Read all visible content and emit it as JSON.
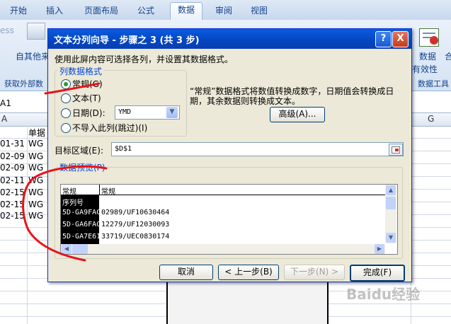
{
  "ribbon": {
    "tabs": [
      "开始",
      "插入",
      "页面布局",
      "公式",
      "数据",
      "审阅",
      "视图"
    ],
    "active_tab": "数据",
    "left_btn_fragment": "ess",
    "left_btn_label": "自其他来",
    "left_group_label": "获取外部数",
    "right_btn_label": "数据",
    "right_btn_label2": "有效性",
    "right_group_label": "数据工具",
    "right_edge_label": "合"
  },
  "sheet": {
    "name_box": "A1",
    "col_a": "A",
    "col_g": "G",
    "header_cell": "单据",
    "rows": [
      {
        "date": "01-31",
        "code": "WG"
      },
      {
        "date": "02-09",
        "code": "WG"
      },
      {
        "date": "02-09",
        "code": "WG"
      },
      {
        "date": "02-11",
        "code": "WG"
      },
      {
        "date": "02-15",
        "code": "WG"
      },
      {
        "date": "02-15",
        "code": "WG"
      },
      {
        "date": "02-15",
        "code": "WG"
      }
    ]
  },
  "dialog": {
    "title": "文本分列向导 - 步骤之 3 (共 3 步)",
    "help_btn": "?",
    "close_btn": "X",
    "instruction": "使用此屏内容可选择各列，并设置其数据格式。",
    "column_format_legend": "列数据格式",
    "options": {
      "general": "常规(G)",
      "text": "文本(T)",
      "date": "日期(D):",
      "skip": "不导入此列(跳过)(I)"
    },
    "date_format_value": "YMD",
    "description": "“常规”数据格式将数值转换成数字，日期值会转换成日期，其余数据则转换成文本。",
    "advanced_btn": "高级(A)...",
    "destination_label": "目标区域(E):",
    "destination_value": "$D$1",
    "preview_legend": "数据预览(P)",
    "preview": {
      "headers": [
        "常规",
        "常规"
      ],
      "rows": [
        [
          "序列号",
          ""
        ],
        [
          "5D-GA9FAC",
          "02989/UF10630464"
        ],
        [
          "5D-GA6FAC",
          "12279/UF12030093"
        ],
        [
          "5D-GA7E61",
          "33719/UEC0830174"
        ]
      ]
    },
    "buttons": {
      "cancel": "取消",
      "back": "< 上一步(B)",
      "next": "下一步(N) >",
      "finish": "完成(F)"
    }
  },
  "watermark": "Baidu经验",
  "colors": {
    "title_bar": "#0a5ce0",
    "dialog_bg": "#ece9d8",
    "ribbon_text": "#15428b",
    "annotation": "#e8121a"
  }
}
